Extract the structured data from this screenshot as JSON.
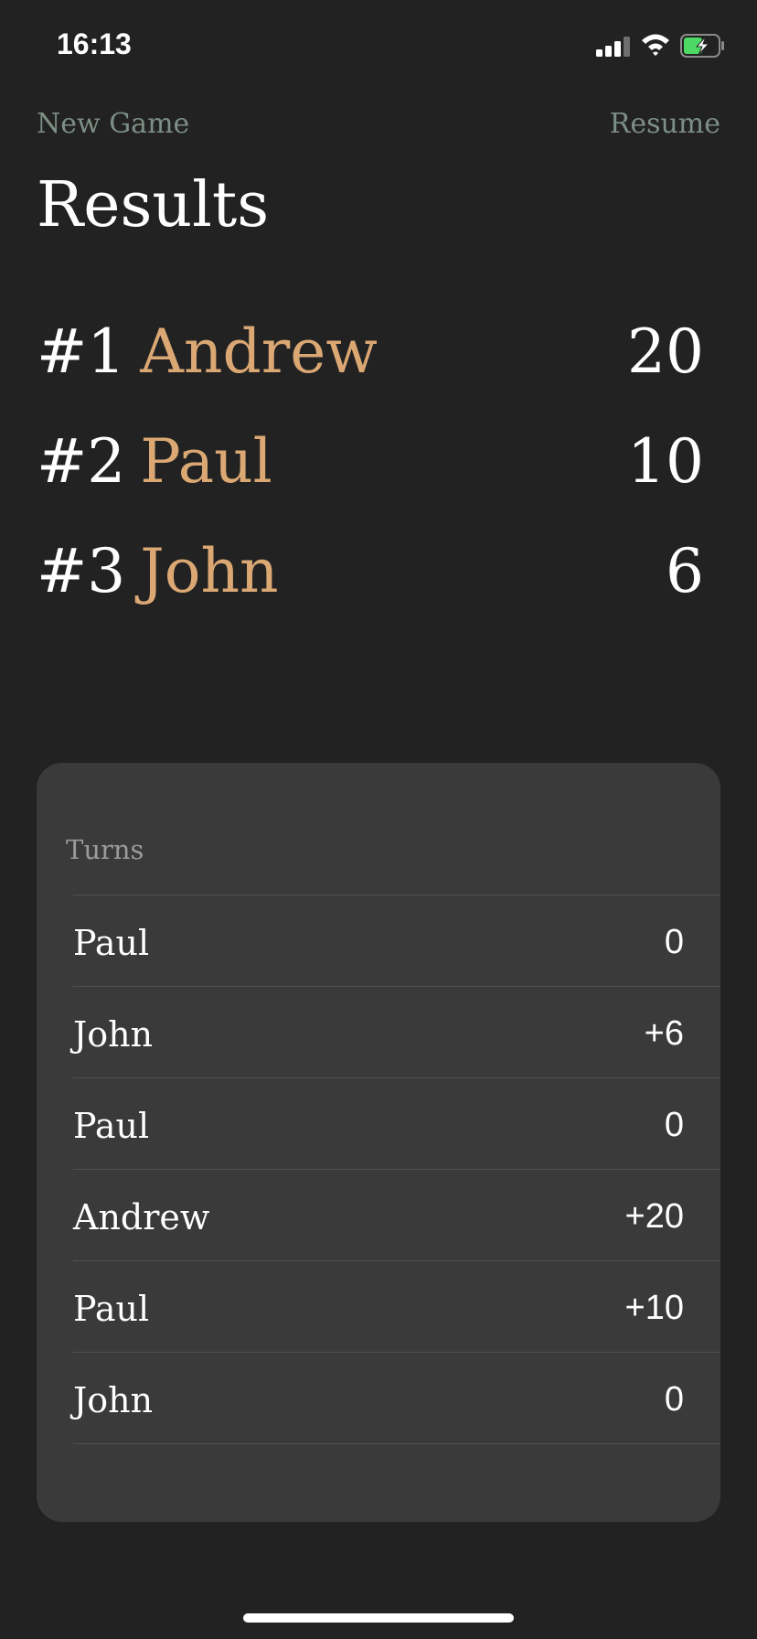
{
  "status_bar": {
    "time": "16:13",
    "icons": [
      "signal-icon",
      "wifi-icon",
      "battery-charging-icon"
    ],
    "battery_color": "#4cd964"
  },
  "nav": {
    "new_game_label": "New Game",
    "resume_label": "Resume",
    "link_color": "#7d8f85"
  },
  "title": "Results",
  "accent_color": "#dba874",
  "rankings": [
    {
      "rank": "#1",
      "name": "Andrew",
      "score": "20"
    },
    {
      "rank": "#2",
      "name": "Paul",
      "score": "10"
    },
    {
      "rank": "#3",
      "name": "John",
      "score": "6"
    }
  ],
  "turns": {
    "header": "Turns",
    "rows": [
      {
        "player": "Paul",
        "points": "0"
      },
      {
        "player": "John",
        "points": "+6"
      },
      {
        "player": "Paul",
        "points": "0"
      },
      {
        "player": "Andrew",
        "points": "+20"
      },
      {
        "player": "Paul",
        "points": "+10"
      },
      {
        "player": "John",
        "points": "0"
      }
    ]
  }
}
